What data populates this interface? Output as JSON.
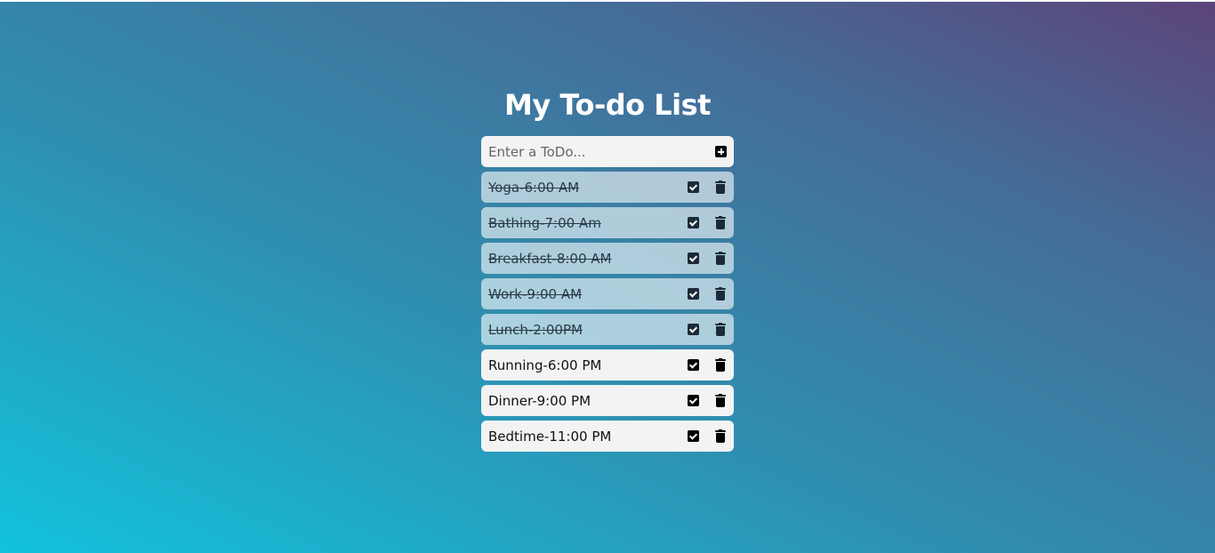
{
  "app": {
    "title": "My To-do List"
  },
  "input": {
    "placeholder": "Enter a ToDo...",
    "value": ""
  },
  "icons": {
    "add": "plus-square-icon",
    "check": "check-square-icon",
    "delete": "trash-icon"
  },
  "todos": [
    {
      "text": "Yoga-6:00 AM",
      "completed": true
    },
    {
      "text": "Bathing-7:00 Am",
      "completed": true
    },
    {
      "text": "Breakfast-8:00 AM",
      "completed": true
    },
    {
      "text": "Work-9:00 AM",
      "completed": true
    },
    {
      "text": "Lunch-2:00PM",
      "completed": true
    },
    {
      "text": "Running-6:00 PM",
      "completed": false
    },
    {
      "text": "Dinner-9:00 PM",
      "completed": false
    },
    {
      "text": "Bedtime-11:00 PM",
      "completed": false
    }
  ],
  "colors": {
    "gradient_start": "#12c2dc",
    "gradient_end": "#5c4479",
    "item_background": "#f3f3f3",
    "title_color": "#ffffff"
  }
}
